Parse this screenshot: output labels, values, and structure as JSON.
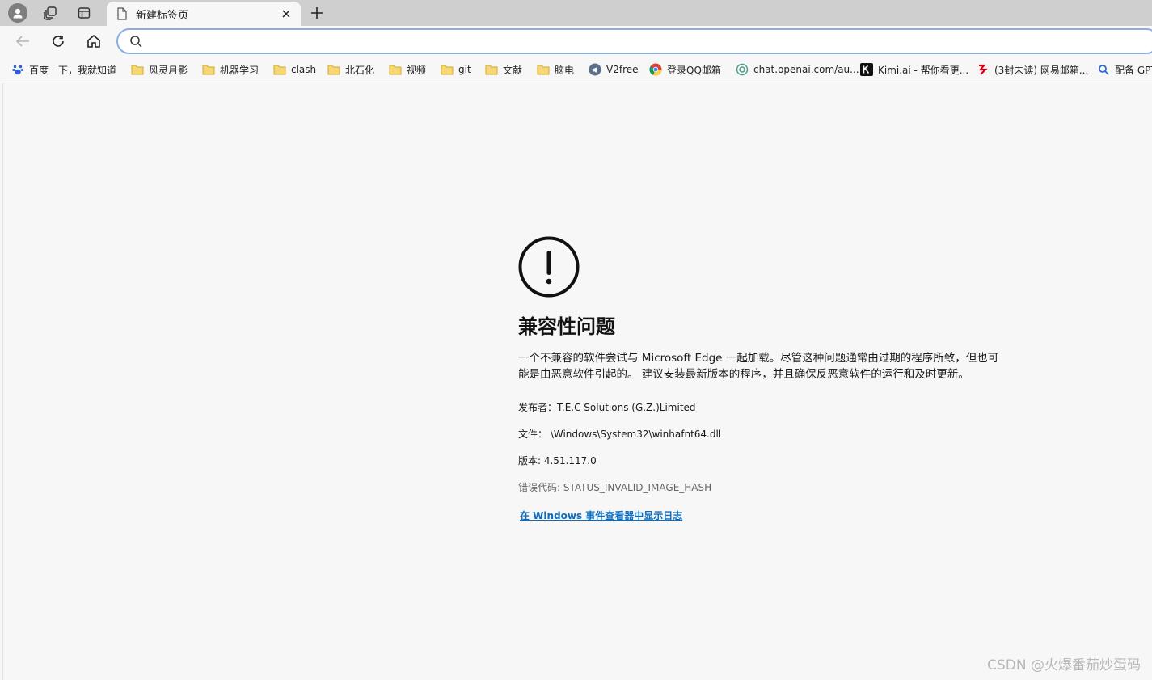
{
  "tab": {
    "title": "新建标签页"
  },
  "address_bar": {
    "value": "",
    "placeholder": ""
  },
  "bookmarks": [
    {
      "label": "百度一下，我就知道",
      "icon": "baidu-icon"
    },
    {
      "label": "风灵月影",
      "icon": "folder-icon"
    },
    {
      "label": "机器学习",
      "icon": "folder-icon"
    },
    {
      "label": "clash",
      "icon": "folder-icon"
    },
    {
      "label": "北石化",
      "icon": "folder-icon"
    },
    {
      "label": "视频",
      "icon": "folder-icon"
    },
    {
      "label": "git",
      "icon": "folder-icon"
    },
    {
      "label": "文献",
      "icon": "folder-icon"
    },
    {
      "label": "脑电",
      "icon": "folder-icon"
    },
    {
      "label": "V2free",
      "icon": "telegram-icon"
    },
    {
      "label": "登录QQ邮箱",
      "icon": "chrome-icon"
    },
    {
      "label": "chat.openai.com/au...",
      "icon": "openai-icon"
    },
    {
      "label": "Kimi.ai - 帮你看更...",
      "icon": "kimi-icon"
    },
    {
      "label": "(3封未读) 网易邮箱...",
      "icon": "netease-icon"
    },
    {
      "label": "配备 GPT",
      "icon": "search-icon"
    }
  ],
  "error": {
    "heading": "兼容性问题",
    "description": "一个不兼容的软件尝试与 Microsoft Edge 一起加载。尽管这种问题通常由过期的程序所致，但也可能是由恶意软件引起的。 建议安装最新版本的程序，并且确保反恶意软件的运行和及时更新。",
    "publisher": "发布者：T.E.C Solutions (G.Z.)Limited",
    "file": "文件： \\Windows\\System32\\winhafnt64.dll",
    "version": "版本: 4.51.117.0",
    "error_code": "错误代码: STATUS_INVALID_IMAGE_HASH",
    "log_link": "在 Windows 事件查看器中显示日志"
  },
  "watermark": "CSDN @火爆番茄炒蛋码",
  "colors": {
    "accent": "#0f6cbd",
    "folder": "#f2c04d",
    "frame": "#cfcfcf"
  }
}
